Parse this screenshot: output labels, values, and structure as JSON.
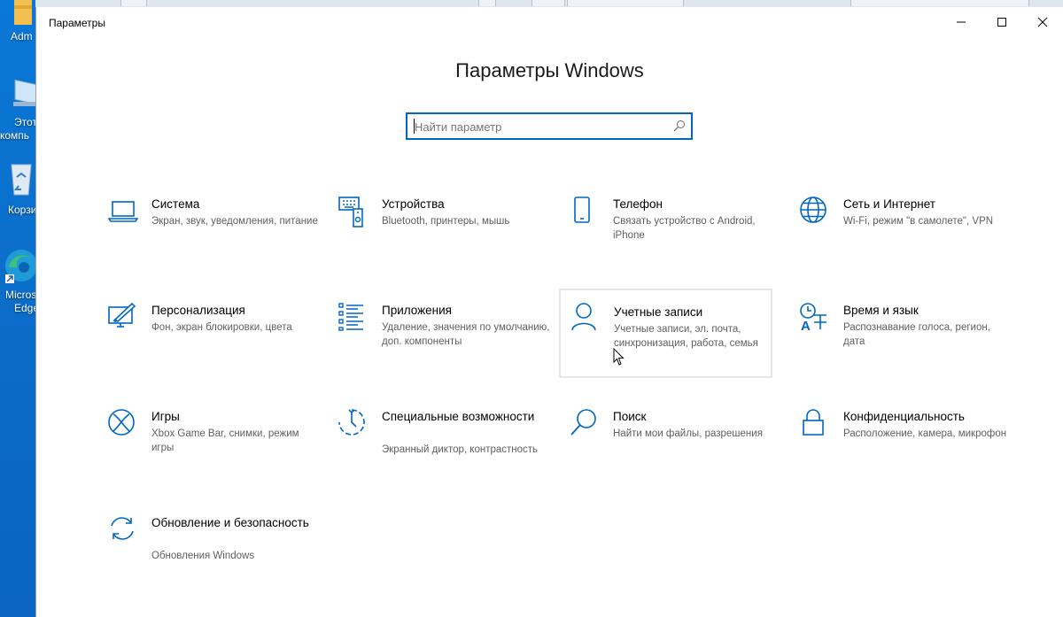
{
  "window": {
    "title": "Параметры",
    "minimize_icon": "minimize-icon",
    "maximize_icon": "maximize-icon",
    "close_icon": "close-icon"
  },
  "heading": "Параметры Windows",
  "search": {
    "placeholder": "Найти параметр",
    "value": "",
    "icon": "search-icon"
  },
  "desktop_icons": [
    {
      "label": "Adm",
      "icon": "folder-icon"
    },
    {
      "label_lines": [
        "Этот",
        "компь"
      ],
      "icon": "this-pc-icon"
    },
    {
      "label": "Корзи",
      "icon": "recycle-bin-icon"
    },
    {
      "label_lines": [
        "Micros",
        "Edge"
      ],
      "icon": "edge-icon"
    }
  ],
  "categories": [
    {
      "title": "Система",
      "desc": "Экран, звук, уведомления, питание",
      "icon": "laptop-icon"
    },
    {
      "title": "Устройства",
      "desc": "Bluetooth, принтеры, мышь",
      "icon": "devices-icon"
    },
    {
      "title": "Телефон",
      "desc": "Связать устройство с Android, iPhone",
      "icon": "phone-icon"
    },
    {
      "title": "Сеть и Интернет",
      "desc": "Wi-Fi, режим \"в самолете\", VPN",
      "icon": "globe-icon"
    },
    {
      "title": "Персонализация",
      "desc": "Фон, экран блокировки, цвета",
      "icon": "personalization-icon"
    },
    {
      "title": "Приложения",
      "desc": "Удаление, значения по умолчанию, доп. компоненты",
      "icon": "apps-list-icon"
    },
    {
      "title": "Учетные записи",
      "desc": "Учетные записи, эл. почта, синхронизация, работа, семья",
      "icon": "person-icon"
    },
    {
      "title": "Время и язык",
      "desc": "Распознавание голоса, регион, дата",
      "icon": "time-language-icon"
    },
    {
      "title": "Игры",
      "desc": "Xbox Game Bar, снимки, режим игры",
      "icon": "xbox-icon"
    },
    {
      "title": "Специальные возможности",
      "desc": "Экранный диктор, контрастность",
      "icon": "accessibility-icon"
    },
    {
      "title": "Поиск",
      "desc": "Найти мои файлы, разрешения",
      "icon": "search-icon"
    },
    {
      "title": "Конфиденциальность",
      "desc": "Расположение, камера, микрофон",
      "icon": "lock-icon"
    },
    {
      "title": "Обновление и безопасность",
      "desc": "Обновления Windows",
      "icon": "update-icon"
    }
  ],
  "colors": {
    "accent": "#0067c0",
    "desktop": "#0a6fcc"
  }
}
